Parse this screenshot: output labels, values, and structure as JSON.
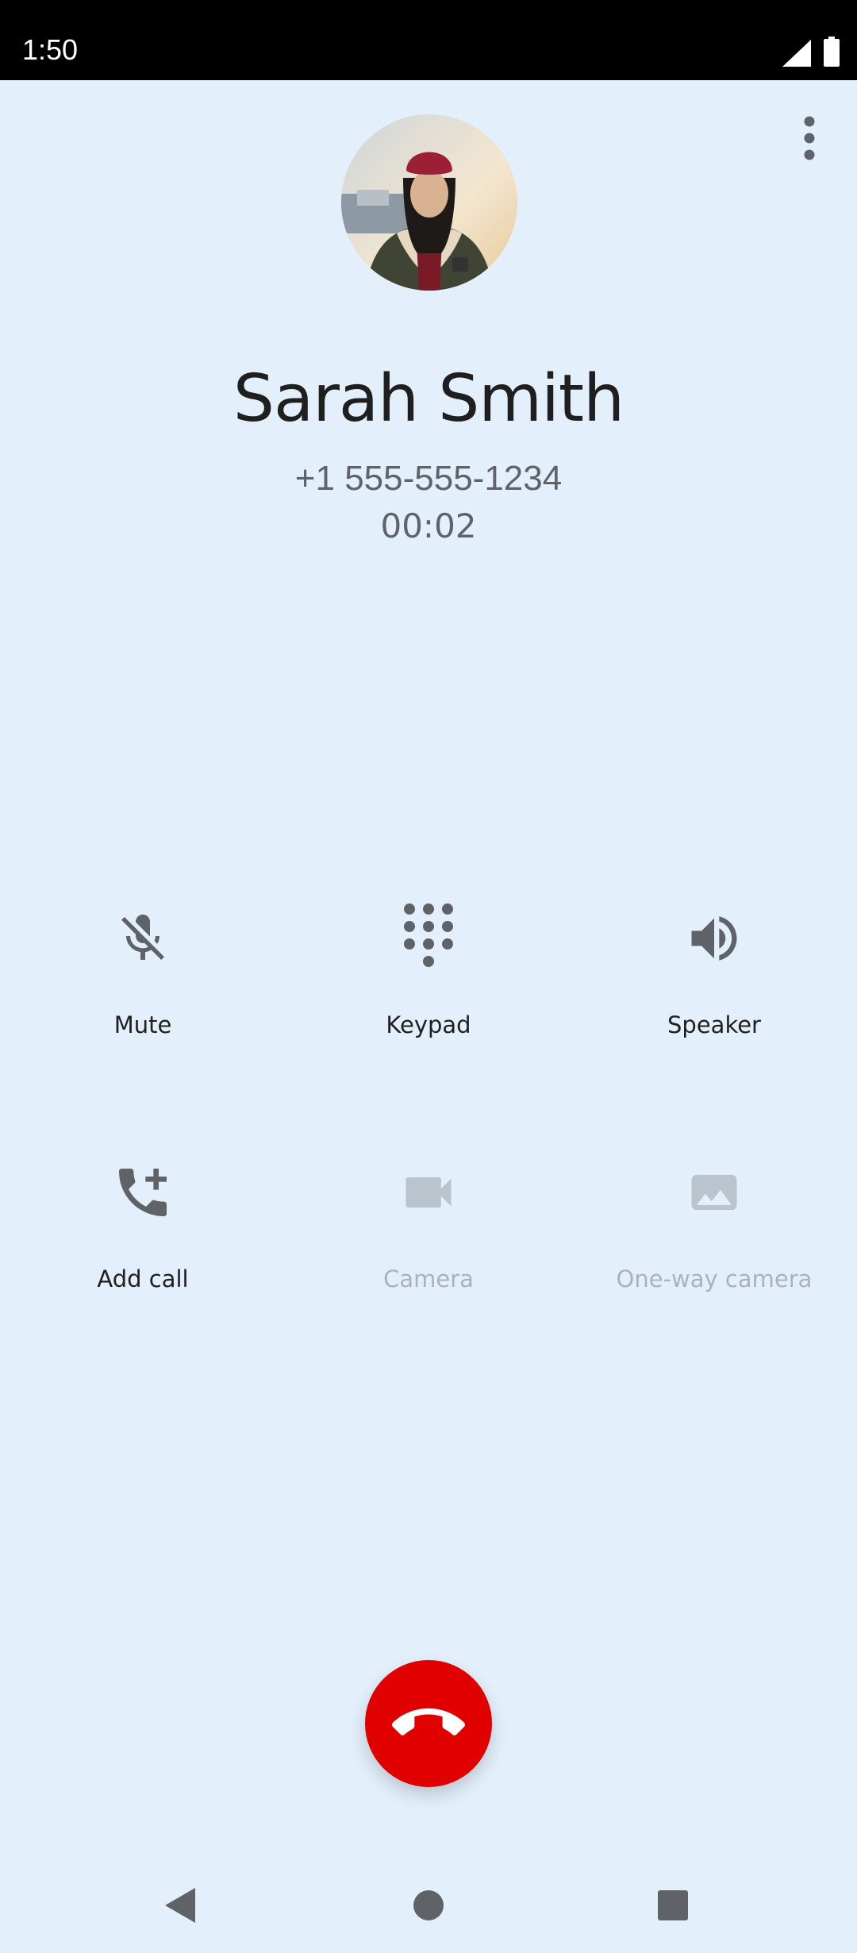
{
  "status_bar": {
    "time": "1:50"
  },
  "caller": {
    "name": "Sarah Smith",
    "number": "+1 555-555-1234",
    "duration": "00:02"
  },
  "controls": {
    "mute": {
      "label": "Mute",
      "icon": "mic-off-icon"
    },
    "keypad": {
      "label": "Keypad",
      "icon": "dialpad-icon"
    },
    "speaker": {
      "label": "Speaker",
      "icon": "volume-up-icon"
    },
    "add_call": {
      "label": "Add call",
      "icon": "add-call-icon"
    },
    "camera": {
      "label": "Camera",
      "icon": "videocam-icon",
      "enabled": false
    },
    "one_way_camera": {
      "label": "One-way camera",
      "icon": "image-icon",
      "enabled": false
    }
  },
  "colors": {
    "background": "#e3f0fc",
    "end_call": "#e10000",
    "icon": "#5f6368",
    "disabled": "#b9c4cd"
  }
}
